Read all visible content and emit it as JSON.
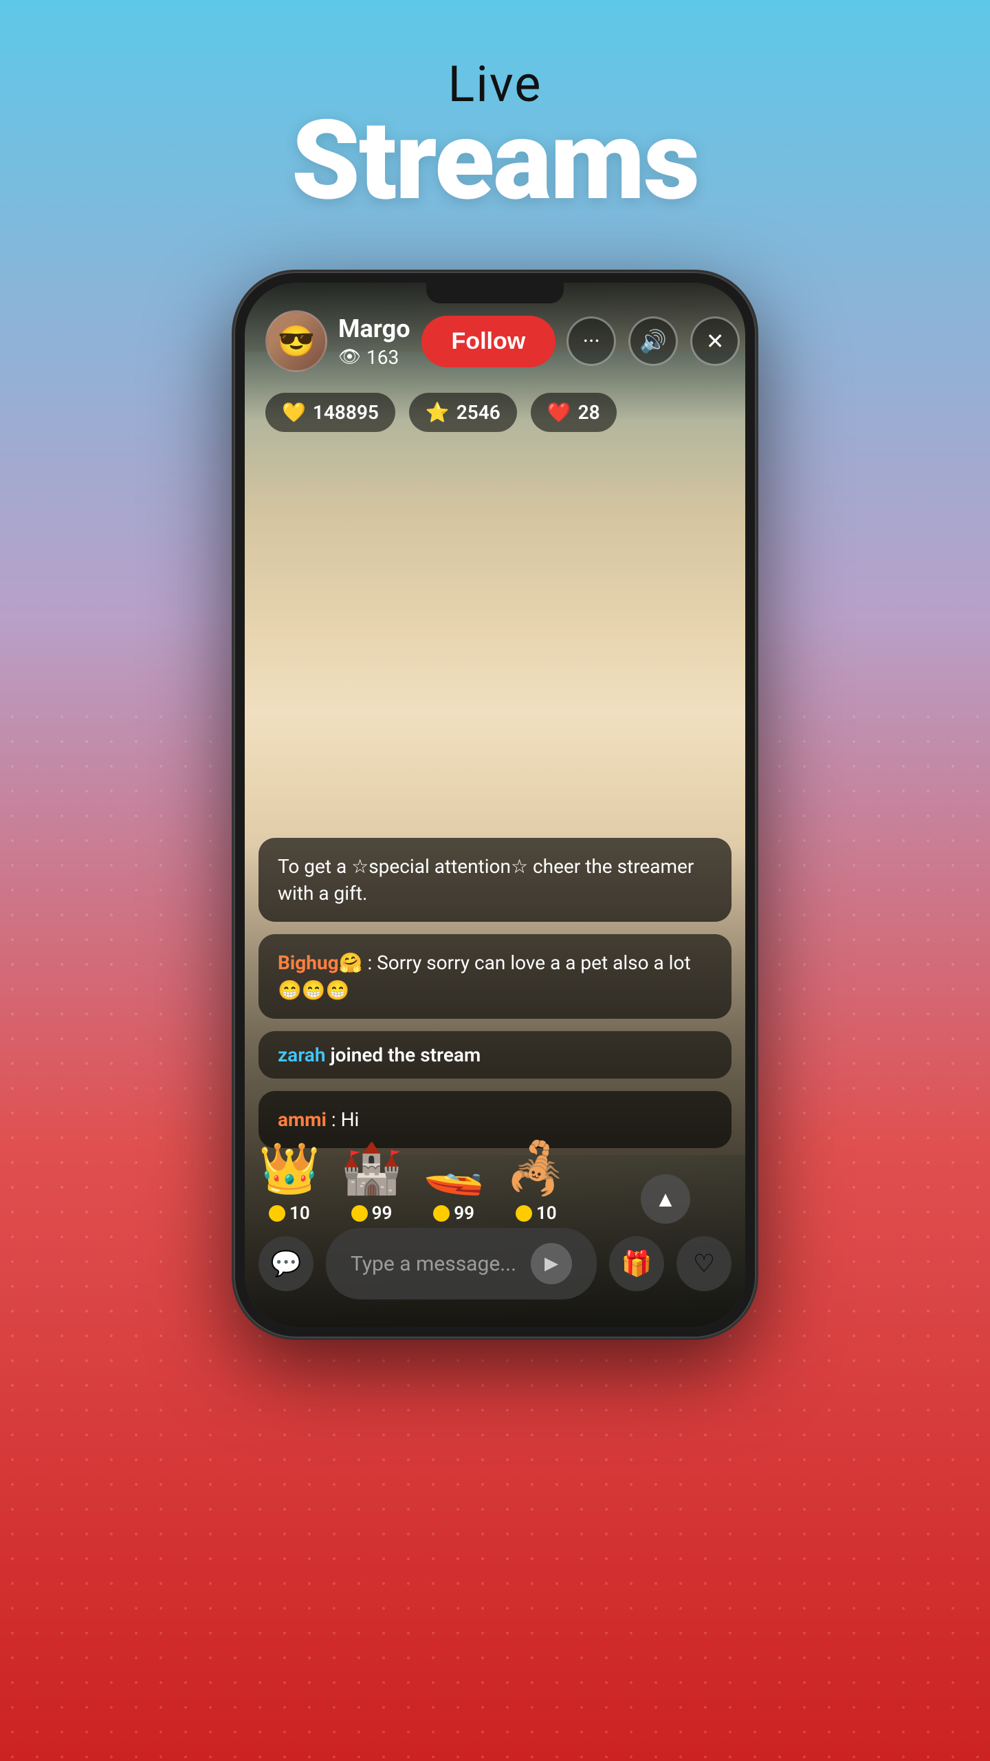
{
  "page": {
    "title_small": "Live",
    "title_large": "Streams",
    "background_gradient_top": "#5ec8e8",
    "background_gradient_mid": "#b8a0c8",
    "background_gradient_bot": "#cc2222"
  },
  "stream": {
    "streamer_name": "Margo",
    "viewer_count": "163",
    "follow_label": "Follow",
    "stats": {
      "coins": "148895",
      "stars": "2546",
      "hearts": "28"
    },
    "actions": {
      "more": "⋯",
      "volume": "🔊",
      "close": "✕"
    }
  },
  "chat": {
    "notice": "To get a ☆special attention☆ cheer the streamer with a gift.",
    "messages": [
      {
        "username": "Bighug🤗",
        "text": ": Sorry sorry can love a a pet also a lot 😁😁😁"
      },
      {
        "join_text": "zarah joined the stream",
        "join_username": "zarah"
      },
      {
        "username": "ammi",
        "text": ": Hi"
      }
    ]
  },
  "gifts": [
    {
      "emoji": "👑",
      "price": "10"
    },
    {
      "emoji": "🏰",
      "price": "99"
    },
    {
      "emoji": "🚤",
      "price": "99"
    },
    {
      "emoji": "🦂",
      "price": "10"
    }
  ],
  "bottom_bar": {
    "chat_icon": "💬",
    "input_placeholder": "Type a message...",
    "send_icon": "▶",
    "gift_icon": "🎁",
    "heart_icon": "♡"
  }
}
